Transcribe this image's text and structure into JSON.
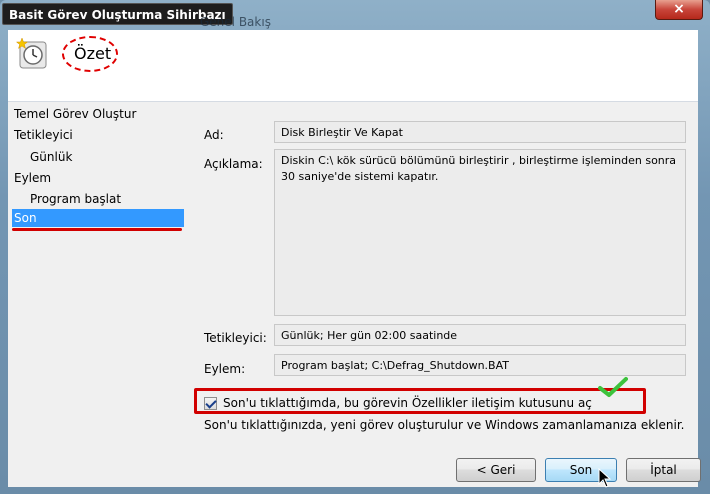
{
  "window": {
    "title": "Basit Görev Oluşturma Sihirbazı",
    "background_text": "Genel Bakış",
    "close_symbol": "×"
  },
  "header": {
    "title": "Özet",
    "icon": "clock-icon"
  },
  "nav": {
    "items": [
      {
        "label": "Temel Görev Oluştur",
        "sub": false,
        "active": false
      },
      {
        "label": "Tetikleyici",
        "sub": false,
        "active": false
      },
      {
        "label": "Günlük",
        "sub": true,
        "active": false
      },
      {
        "label": "Eylem",
        "sub": false,
        "active": false
      },
      {
        "label": "Program başlat",
        "sub": true,
        "active": false
      },
      {
        "label": "Son",
        "sub": false,
        "active": true
      }
    ]
  },
  "summary": {
    "name_label": "Ad:",
    "name_value": "Disk Birleştir Ve Kapat",
    "description_label": "Açıklama:",
    "description_value": "Diskin C:\\ kök sürücü bölümünü birleştirir , birleştirme işleminden sonra 30 saniye'de sistemi kapatır.",
    "trigger_label": "Tetikleyici:",
    "trigger_value": "Günlük; Her gün 02:00 saatinde",
    "action_label": "Eylem:",
    "action_value": "Program başlat; C:\\Defrag_Shutdown.BAT"
  },
  "options": {
    "open_properties_label": "Son'u tıklattığımda, bu görevin Özellikler iletişim kutusunu aç",
    "open_properties_checked": true,
    "info_text": "Son'u tıklattığınızda, yeni görev oluşturulur ve Windows zamanlamanıza eklenir."
  },
  "buttons": {
    "back": "< Geri",
    "finish": "Son",
    "cancel": "İptal"
  },
  "colors": {
    "selection": "#3399ff",
    "annotation_red": "#d10000",
    "annotation_green": "#3cc23c"
  }
}
